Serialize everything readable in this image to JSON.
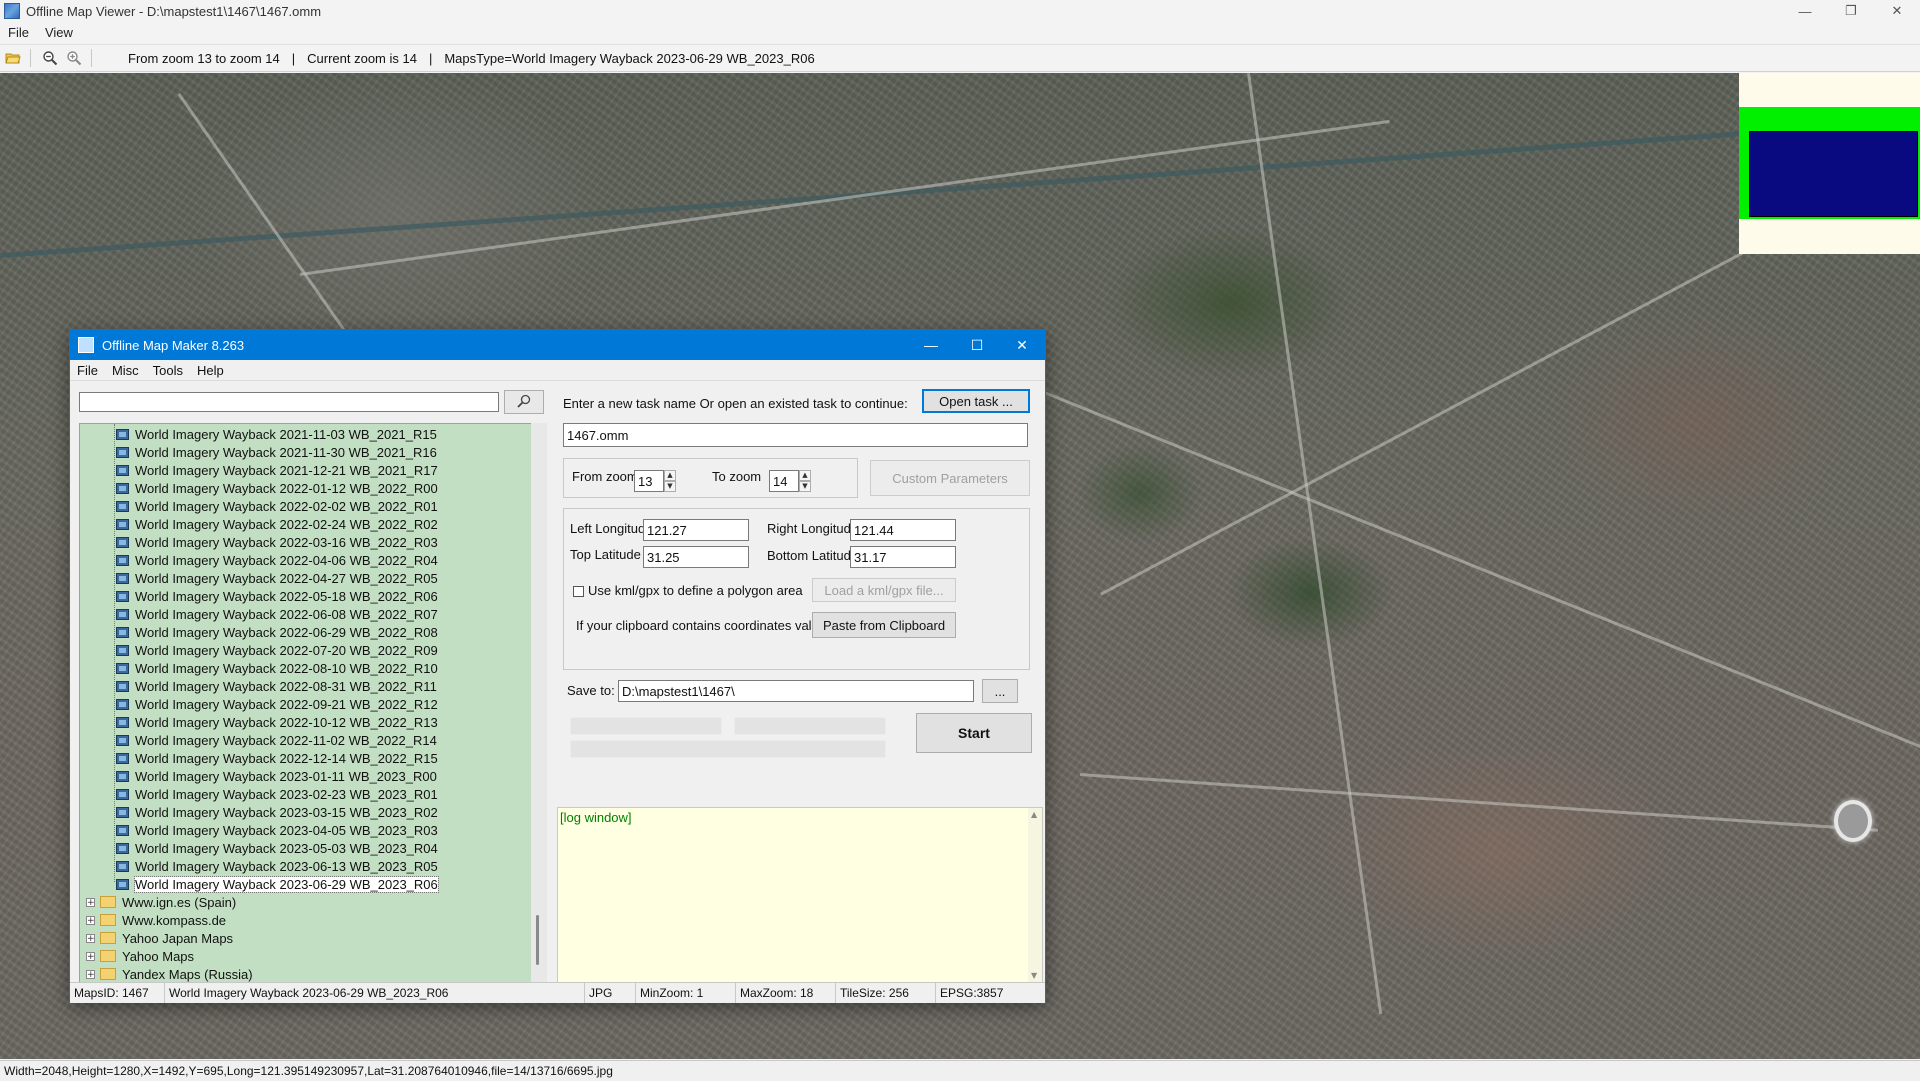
{
  "window": {
    "title": "Offline Map Viewer - D:\\mapstest1\\1467\\1467.omm",
    "controls": {
      "minimize": "—",
      "maximize": "❐",
      "close": "✕"
    }
  },
  "menubar": {
    "items": [
      "File",
      "View"
    ]
  },
  "toolbar": {
    "icons": [
      "open-folder-icon",
      "zoom-out-icon",
      "zoom-in-icon"
    ],
    "zoom_range": "From zoom 13 to zoom 14",
    "current_zoom": "Current zoom is 14",
    "maps_type": "MapsType=World Imagery Wayback 2023-06-29 WB_2023_R06",
    "separator": "|"
  },
  "map": {
    "overview_colors": {
      "background": "#fffbea",
      "band": "#00f000",
      "viewport": "#0a0a80"
    }
  },
  "statusbar": {
    "text": "Width=2048,Height=1280,X=1492,Y=695,Long=121.395149230957,Lat=31.208764010946,file=14/13716/6695.jpg"
  },
  "dialog": {
    "title": "Offline Map Maker 8.263",
    "controls": {
      "minimize": "—",
      "maximize": "☐",
      "close": "✕"
    },
    "menu": [
      "File",
      "Misc",
      "Tools",
      "Help"
    ],
    "search": {
      "value": "",
      "placeholder": ""
    },
    "tree": {
      "children": [
        "World Imagery Wayback 2021-11-03 WB_2021_R15",
        "World Imagery Wayback 2021-11-30 WB_2021_R16",
        "World Imagery Wayback 2021-12-21 WB_2021_R17",
        "World Imagery Wayback 2022-01-12 WB_2022_R00",
        "World Imagery Wayback 2022-02-02 WB_2022_R01",
        "World Imagery Wayback 2022-02-24 WB_2022_R02",
        "World Imagery Wayback 2022-03-16 WB_2022_R03",
        "World Imagery Wayback 2022-04-06 WB_2022_R04",
        "World Imagery Wayback 2022-04-27 WB_2022_R05",
        "World Imagery Wayback 2022-05-18 WB_2022_R06",
        "World Imagery Wayback 2022-06-08 WB_2022_R07",
        "World Imagery Wayback 2022-06-29 WB_2022_R08",
        "World Imagery Wayback 2022-07-20 WB_2022_R09",
        "World Imagery Wayback 2022-08-10 WB_2022_R10",
        "World Imagery Wayback 2022-08-31 WB_2022_R11",
        "World Imagery Wayback 2022-09-21 WB_2022_R12",
        "World Imagery Wayback 2022-10-12 WB_2022_R13",
        "World Imagery Wayback 2022-11-02 WB_2022_R14",
        "World Imagery Wayback 2022-12-14 WB_2022_R15",
        "World Imagery Wayback 2023-01-11 WB_2023_R00",
        "World Imagery Wayback 2023-02-23 WB_2023_R01",
        "World Imagery Wayback 2023-03-15 WB_2023_R02",
        "World Imagery Wayback 2023-04-05 WB_2023_R03",
        "World Imagery Wayback 2023-05-03 WB_2023_R04",
        "World Imagery Wayback 2023-06-13 WB_2023_R05",
        "World Imagery Wayback 2023-06-29 WB_2023_R06"
      ],
      "selected_index": 25,
      "folders": [
        "Www.ign.es (Spain)",
        "Www.kompass.de",
        "Yahoo Japan Maps",
        "Yahoo Maps",
        "Yandex Maps (Russia)"
      ],
      "expander": "+"
    },
    "task": {
      "prompt": "Enter a new task name Or open an existed task to continue:",
      "open_button": "Open task ...",
      "name_value": "1467.omm"
    },
    "zoom": {
      "from_label": "From zoom",
      "from_value": "13",
      "to_label": "To zoom",
      "to_value": "14",
      "custom_button": "Custom Parameters"
    },
    "coords": {
      "left_lon_label": "Left Longitude",
      "left_lon": "121.27",
      "right_lon_label": "Right Longitude",
      "right_lon": "121.44",
      "top_lat_label": "Top Latitude",
      "top_lat": "31.25",
      "bottom_lat_label": "Bottom Latitude",
      "bottom_lat": "31.17",
      "kml_checkbox_label": "Use kml/gpx to define a polygon area",
      "kml_checked": false,
      "load_kml_button": "Load a kml/gpx file...",
      "clipboard_label": "If your clipboard contains coordinates values:",
      "paste_button": "Paste from Clipboard"
    },
    "save": {
      "label": "Save to:",
      "value": "D:\\mapstest1\\1467\\",
      "browse_button": "..."
    },
    "start_button": "Start",
    "log": {
      "text": "[log window]"
    },
    "status": {
      "maps_id": "MapsID: 1467",
      "maps_name": "World Imagery Wayback 2023-06-29 WB_2023_R06",
      "format": "JPG",
      "min_zoom": "MinZoom: 1",
      "max_zoom": "MaxZoom: 18",
      "tile_size": "TileSize: 256",
      "epsg": "EPSG:3857"
    }
  }
}
